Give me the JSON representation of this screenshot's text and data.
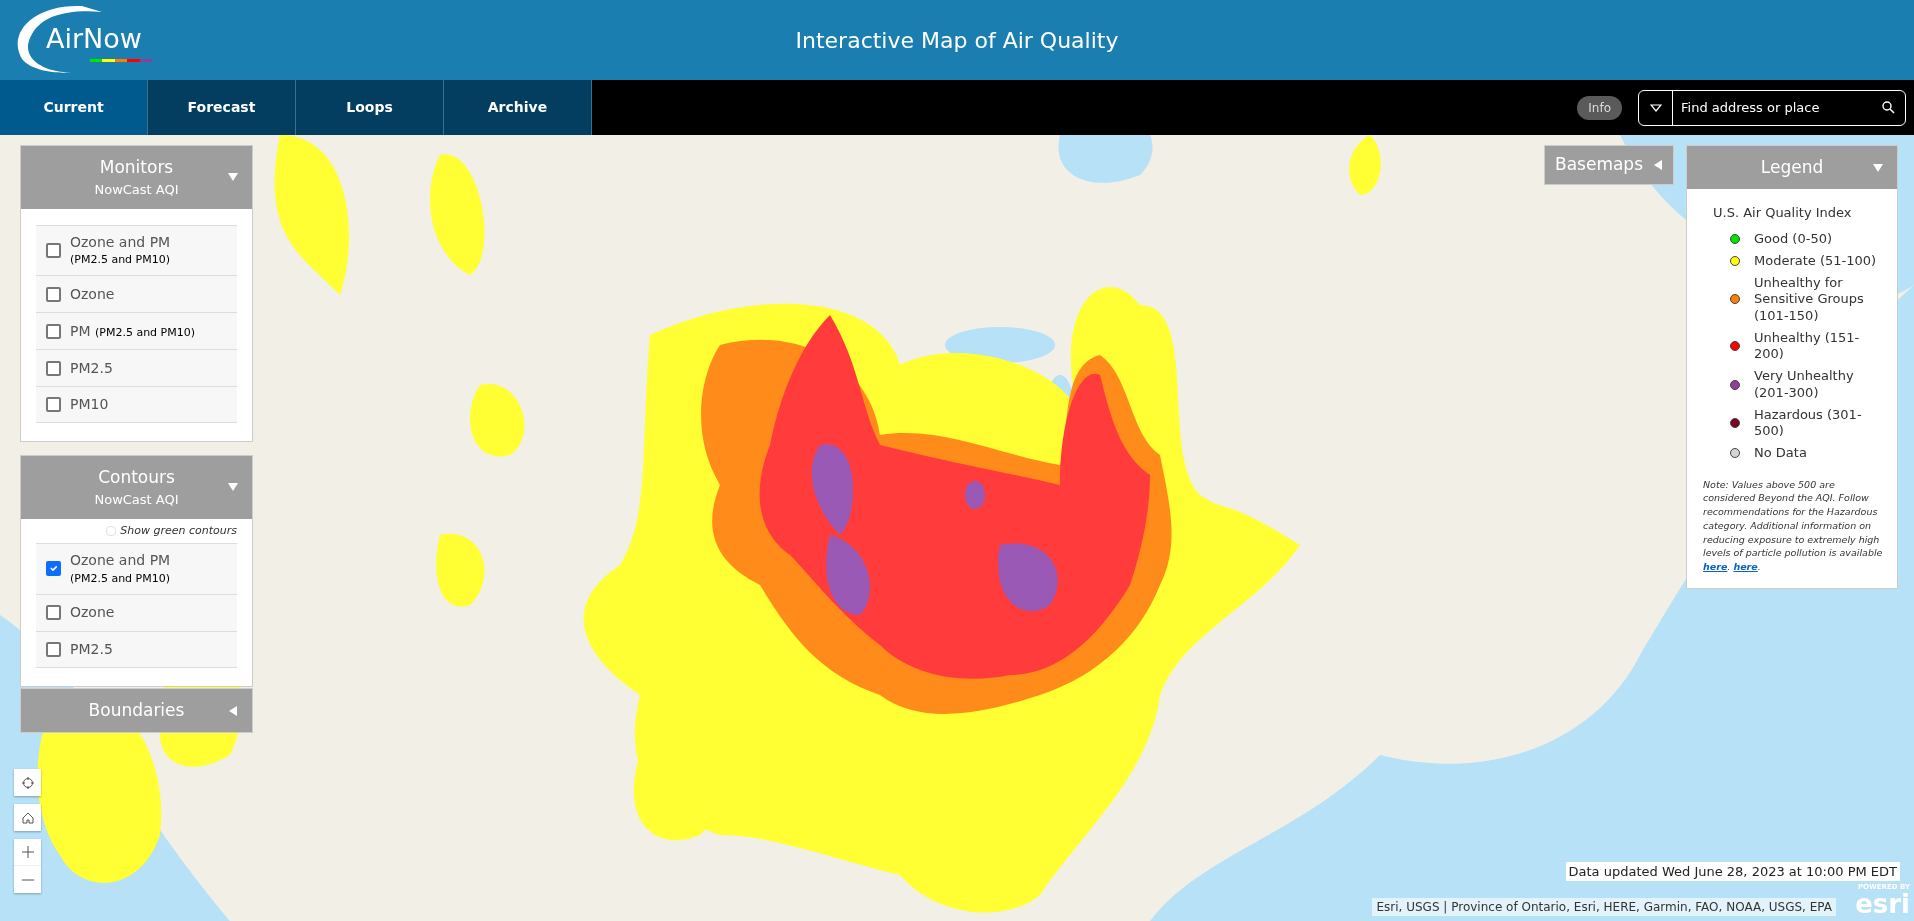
{
  "header": {
    "logo": "AirNow",
    "title": "Interactive Map of Air Quality"
  },
  "tabs": [
    {
      "label": "Current",
      "selected": true
    },
    {
      "label": "Forecast",
      "selected": false
    },
    {
      "label": "Loops",
      "selected": false
    },
    {
      "label": "Archive",
      "selected": false
    }
  ],
  "info_button": "Info",
  "search": {
    "placeholder": "Find address or place"
  },
  "panels": [
    {
      "title": "Monitors",
      "subtitle": "NowCast AQI",
      "expanded": true,
      "options": [
        {
          "label": "Ozone and PM",
          "note": "(PM2.5 and PM10)",
          "kind": "stacked",
          "checked": false
        },
        {
          "label": "Ozone",
          "kind": "plain",
          "checked": false
        },
        {
          "label": "PM",
          "note": "(PM2.5 and PM10)",
          "kind": "inline",
          "checked": false
        },
        {
          "label": "PM2.5",
          "kind": "plain",
          "checked": false
        },
        {
          "label": "PM10",
          "kind": "plain",
          "checked": false
        }
      ]
    },
    {
      "title": "Contours",
      "subtitle": "NowCast AQI",
      "expanded": true,
      "toggle": {
        "label": "Show green contours",
        "checked": false
      },
      "options": [
        {
          "label": "Ozone and PM",
          "note": "(PM2.5 and PM10)",
          "kind": "stacked",
          "checked": true
        },
        {
          "label": "Ozone",
          "kind": "plain",
          "checked": false
        },
        {
          "label": "PM2.5",
          "kind": "plain",
          "checked": false
        }
      ]
    },
    {
      "title": "Boundaries",
      "expanded": false
    }
  ],
  "basemaps": {
    "title": "Basemaps",
    "expanded": false
  },
  "legend": {
    "title": "Legend",
    "expanded": true,
    "heading": "U.S. Air Quality Index",
    "items": [
      {
        "label": "Good (0-50)",
        "color": "#00e400"
      },
      {
        "label": "Moderate (51-100)",
        "color": "#ffff00"
      },
      {
        "label": "Unhealthy for Sensitive Groups (101-150)",
        "color": "#ff7e00"
      },
      {
        "label": "Unhealthy (151-200)",
        "color": "#ff0000"
      },
      {
        "label": "Very Unhealthy (201-300)",
        "color": "#8f3f97"
      },
      {
        "label": "Hazardous (301-500)",
        "color": "#7e0023"
      },
      {
        "label": "No Data",
        "color": "#d3d3d3"
      }
    ],
    "note": [
      {
        "kind": "text",
        "text": "Note: Values above 500 are considered Beyond the AQI. Follow recommendations for the Hazardous category. Additional information on reducing exposure to extremely high levels of particle pollution is available "
      },
      {
        "kind": "link",
        "text": "here"
      },
      {
        "kind": "text",
        "text": ". "
      },
      {
        "kind": "link",
        "text": "here"
      },
      {
        "kind": "text",
        "text": "."
      }
    ]
  },
  "updated": "Data updated Wed June 28, 2023 at 10:00 PM EDT",
  "attribution": "Esri, USGS | Province of Ontario, Esri, HERE, Garmin, FAO, NOAA, USGS, EPA",
  "esri": {
    "powered_by": "POWERED BY",
    "brand": "esri"
  }
}
